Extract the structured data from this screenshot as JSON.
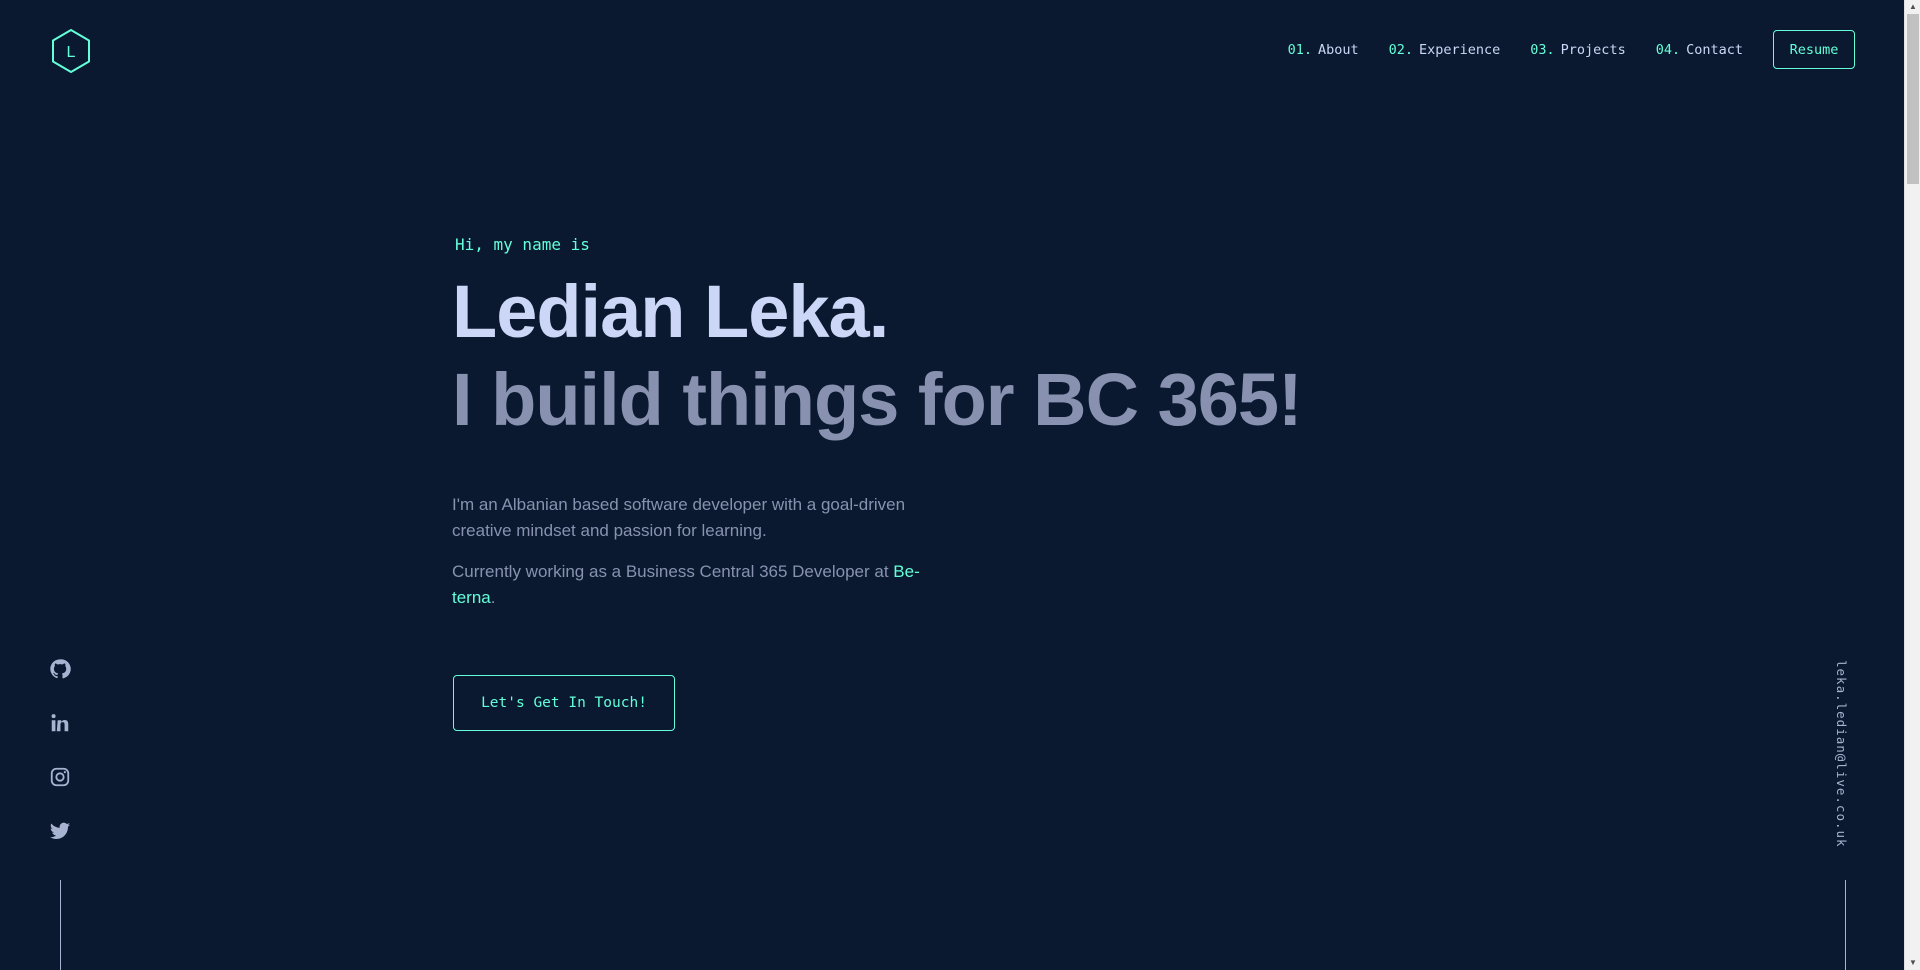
{
  "header": {
    "logo_letter": "L",
    "nav": [
      {
        "num": "01.",
        "label": "About"
      },
      {
        "num": "02.",
        "label": "Experience"
      },
      {
        "num": "03.",
        "label": "Projects"
      },
      {
        "num": "04.",
        "label": "Contact"
      }
    ],
    "resume_label": "Resume"
  },
  "hero": {
    "greeting": "Hi, my name is",
    "name": "Ledian Leka.",
    "tagline": "I build things for BC 365!",
    "bio_1": "I'm an Albanian based software developer with a goal-driven creative mindset and passion for learning.",
    "bio_2_prefix": "Currently working as a Business Central 365 Developer at",
    "company": "Be-terna",
    "bio_2_suffix": ".",
    "cta_label": "Let's Get In Touch!"
  },
  "social": [
    {
      "icon": "github-icon"
    },
    {
      "icon": "linkedin-icon"
    },
    {
      "icon": "instagram-icon"
    },
    {
      "icon": "twitter-icon"
    }
  ],
  "email": "leka.ledian@live.co.uk",
  "colors": {
    "background": "#0a192f",
    "accent": "#64ffda",
    "heading": "#ccd6f6",
    "muted": "#8892b0"
  }
}
